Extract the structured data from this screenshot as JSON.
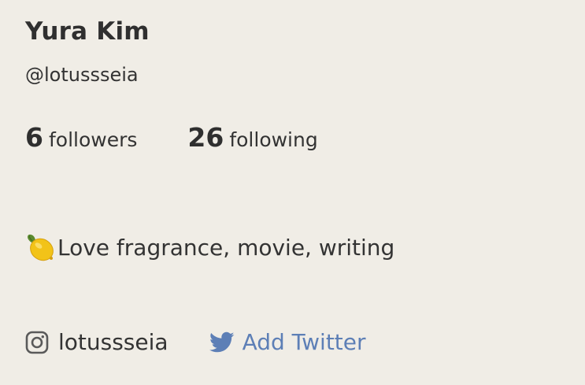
{
  "profile": {
    "name": "Yura Kim",
    "handle": "@lotussseia",
    "bio": "Love fragrance, movie, writing",
    "bio_icon": "lemon-icon"
  },
  "stats": {
    "followers_count": "6",
    "followers_label": "followers",
    "following_count": "26",
    "following_label": "following"
  },
  "socials": {
    "instagram": {
      "icon": "instagram-icon",
      "label": "lotussseia"
    },
    "twitter": {
      "icon": "twitter-icon",
      "label": "Add Twitter"
    }
  },
  "colors": {
    "background": "#f0ede6",
    "text": "#2f2f2f",
    "twitter_accent": "#5d7fb6",
    "icon_gray": "#5a5a5a"
  }
}
